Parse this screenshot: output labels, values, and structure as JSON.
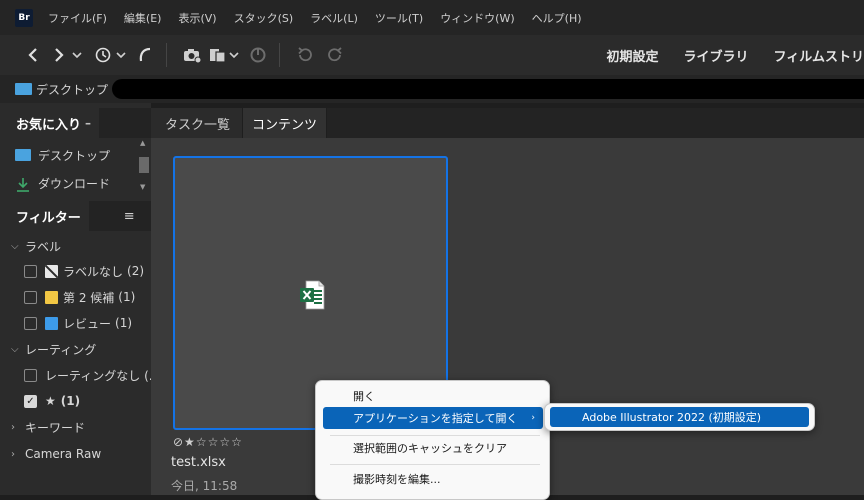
{
  "app": {
    "logo_text": "Br"
  },
  "menubar": {
    "items": [
      "ファイル(F)",
      "編集(E)",
      "表示(V)",
      "スタック(S)",
      "ラベル(L)",
      "ツール(T)",
      "ウィンドウ(W)",
      "ヘルプ(H)"
    ]
  },
  "toolbar": {
    "icons": [
      "back-arrow-icon",
      "forward-arrow-icon",
      "chevron-down-icon",
      "recent-history-icon",
      "boomerang-icon",
      "camera-get-photos-icon",
      "copy-icon",
      "refine-icon",
      "rotate-left-icon",
      "rotate-right-icon"
    ],
    "workspaces": [
      "初期設定",
      "ライブラリ",
      "フィルムストリ"
    ]
  },
  "pathbar": {
    "location": "デスクトップ",
    "arrow": "›"
  },
  "favorites": {
    "tab_label": "お気に入り",
    "collapse_glyph": "–",
    "items": [
      {
        "label": "デスクトップ",
        "icon": "desktop-folder-icon",
        "color": "#4aa3df"
      },
      {
        "label": "ダウンロード",
        "icon": "download-icon",
        "color": "#3fa86a"
      }
    ]
  },
  "filter": {
    "tab_label": "フィルター",
    "menu_glyph": "≡",
    "sections": {
      "label": {
        "title": "ラベル",
        "expanded": true
      },
      "rating": {
        "title": "レーティング",
        "expanded": true
      },
      "keyword": {
        "title": "キーワード",
        "expanded": false
      },
      "camera_raw": {
        "title": "Camera Raw",
        "expanded": false
      }
    },
    "label_items": [
      {
        "label": "ラベルなし",
        "count": "(2)",
        "color": "#e8e8e8"
      },
      {
        "label": "第 2 候補",
        "count": "(1)",
        "color": "#f2c744"
      },
      {
        "label": "レビュー",
        "count": "(1)",
        "color": "#3d9be9"
      }
    ],
    "rating_items": [
      {
        "label": "レーティングなし (...",
        "count": "",
        "checked": false
      },
      {
        "label": "★",
        "count": "(1)",
        "checked": true
      }
    ]
  },
  "content": {
    "tabs": [
      "タスク一覧",
      "コンテンツ"
    ],
    "active_tab": "コンテンツ",
    "thumbnail": {
      "file_icon": "excel-file-icon",
      "rating_display": "⊘★☆☆☆☆",
      "filename": "test.xlsx",
      "date": "今日, 11:58"
    }
  },
  "context_menu": {
    "items": [
      {
        "label": "開く"
      },
      {
        "label": "アプリケーションを指定して開く",
        "submenu": true,
        "highlighted": true
      },
      {
        "label": "選択範囲のキャッシュをクリア"
      },
      {
        "label": "撮影時刻を編集..."
      }
    ],
    "submenu_items": [
      {
        "label": "Adobe Illustrator 2022 (初期設定)",
        "highlighted": true
      }
    ]
  },
  "colors": {
    "accent": "#1473e6",
    "menu_highlight": "#0a64b8",
    "excel_green": "#1d7044"
  }
}
